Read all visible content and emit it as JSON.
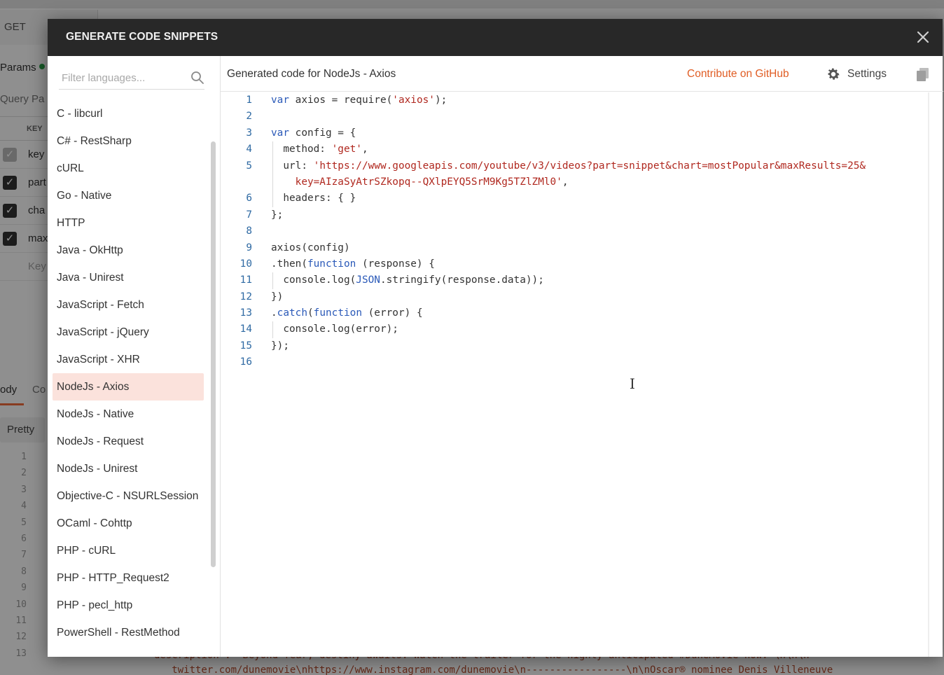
{
  "background": {
    "method": "GET",
    "params_tab": "Params",
    "query_params_label": "Query Pa",
    "key_header": "KEY",
    "rows": [
      "key",
      "part",
      "cha",
      "max"
    ],
    "key_placeholder": "Key",
    "body_tab": "ody",
    "cookies_tab": "Co",
    "pretty_label": "Pretty",
    "line_numbers": [
      "1",
      "2",
      "3",
      "4",
      "5",
      "6",
      "7",
      "8",
      "9",
      "10",
      "11",
      "12",
      "13"
    ],
    "bottom_text": "description\": \"Beyond fear, destiny awaits. Watch the trailer for the highly anticipated #DuneMovie now. \\n\\n\\n--\n   twitter.com/dunemovie\\nhttps://www.instagram.com/dunemovie\\n-----------------\\n\\nOscar® nominee Denis Villeneuve"
  },
  "modal": {
    "title": "GENERATE CODE SNIPPETS",
    "filter_placeholder": "Filter languages...",
    "languages": [
      "C - libcurl",
      "C# - RestSharp",
      "cURL",
      "Go - Native",
      "HTTP",
      "Java - OkHttp",
      "Java - Unirest",
      "JavaScript - Fetch",
      "JavaScript - jQuery",
      "JavaScript - XHR",
      "NodeJs - Axios",
      "NodeJs - Native",
      "NodeJs - Request",
      "NodeJs - Unirest",
      "Objective-C - NSURLSession",
      "OCaml - Cohttp",
      "PHP - cURL",
      "PHP - HTTP_Request2",
      "PHP - pecl_http",
      "PowerShell - RestMethod"
    ],
    "selected_language": "NodeJs - Axios",
    "generated_title": "Generated code for NodeJs - Axios",
    "contribute_link": "Contribute on GitHub",
    "settings_label": "Settings",
    "line_numbers": [
      "1",
      "2",
      "3",
      "4",
      "5",
      "",
      "6",
      "7",
      "8",
      "9",
      "10",
      "11",
      "12",
      "13",
      "14",
      "15",
      "16"
    ],
    "code_lines": [
      [
        [
          "kw",
          "var"
        ],
        [
          "p",
          " axios = require("
        ],
        [
          "str",
          "'axios'"
        ],
        [
          "p",
          ");"
        ]
      ],
      [],
      [
        [
          "kw",
          "var"
        ],
        [
          "p",
          " config = {"
        ]
      ],
      [
        [
          "p",
          "  method: "
        ],
        [
          "str",
          "'get'"
        ],
        [
          "p",
          ","
        ]
      ],
      [
        [
          "p",
          "  url: "
        ],
        [
          "str",
          "'https://www.googleapis.com/youtube/v3/videos?part=snippet&chart=mostPopular&maxResults=25&"
        ]
      ],
      [
        [
          "str",
          "    key=AIzaSyAtrSZkopq--QXlpEYQ5SrM9Kg5TZlZMl0'"
        ],
        [
          "p",
          ","
        ]
      ],
      [
        [
          "p",
          "  headers: { }"
        ]
      ],
      [
        [
          "p",
          "};"
        ]
      ],
      [],
      [
        [
          "p",
          "axios(config)"
        ]
      ],
      [
        [
          "p",
          ".then("
        ],
        [
          "kw",
          "function"
        ],
        [
          "p",
          " (response) {"
        ]
      ],
      [
        [
          "p",
          "  console.log("
        ],
        [
          "kw",
          "JSON"
        ],
        [
          "p",
          ".stringify(response.data));"
        ]
      ],
      [
        [
          "p",
          "})"
        ]
      ],
      [
        [
          "p",
          "."
        ],
        [
          "kw",
          "catch"
        ],
        [
          "p",
          "("
        ],
        [
          "kw",
          "function"
        ],
        [
          "p",
          " (error) {"
        ]
      ],
      [
        [
          "p",
          "  console.log(error);"
        ]
      ],
      [
        [
          "p",
          "});"
        ]
      ],
      []
    ],
    "guide_rows": [
      3,
      4,
      5,
      6,
      11,
      14
    ],
    "accent_color": "#e05d24",
    "selected_bg": "#fbe2dc"
  }
}
